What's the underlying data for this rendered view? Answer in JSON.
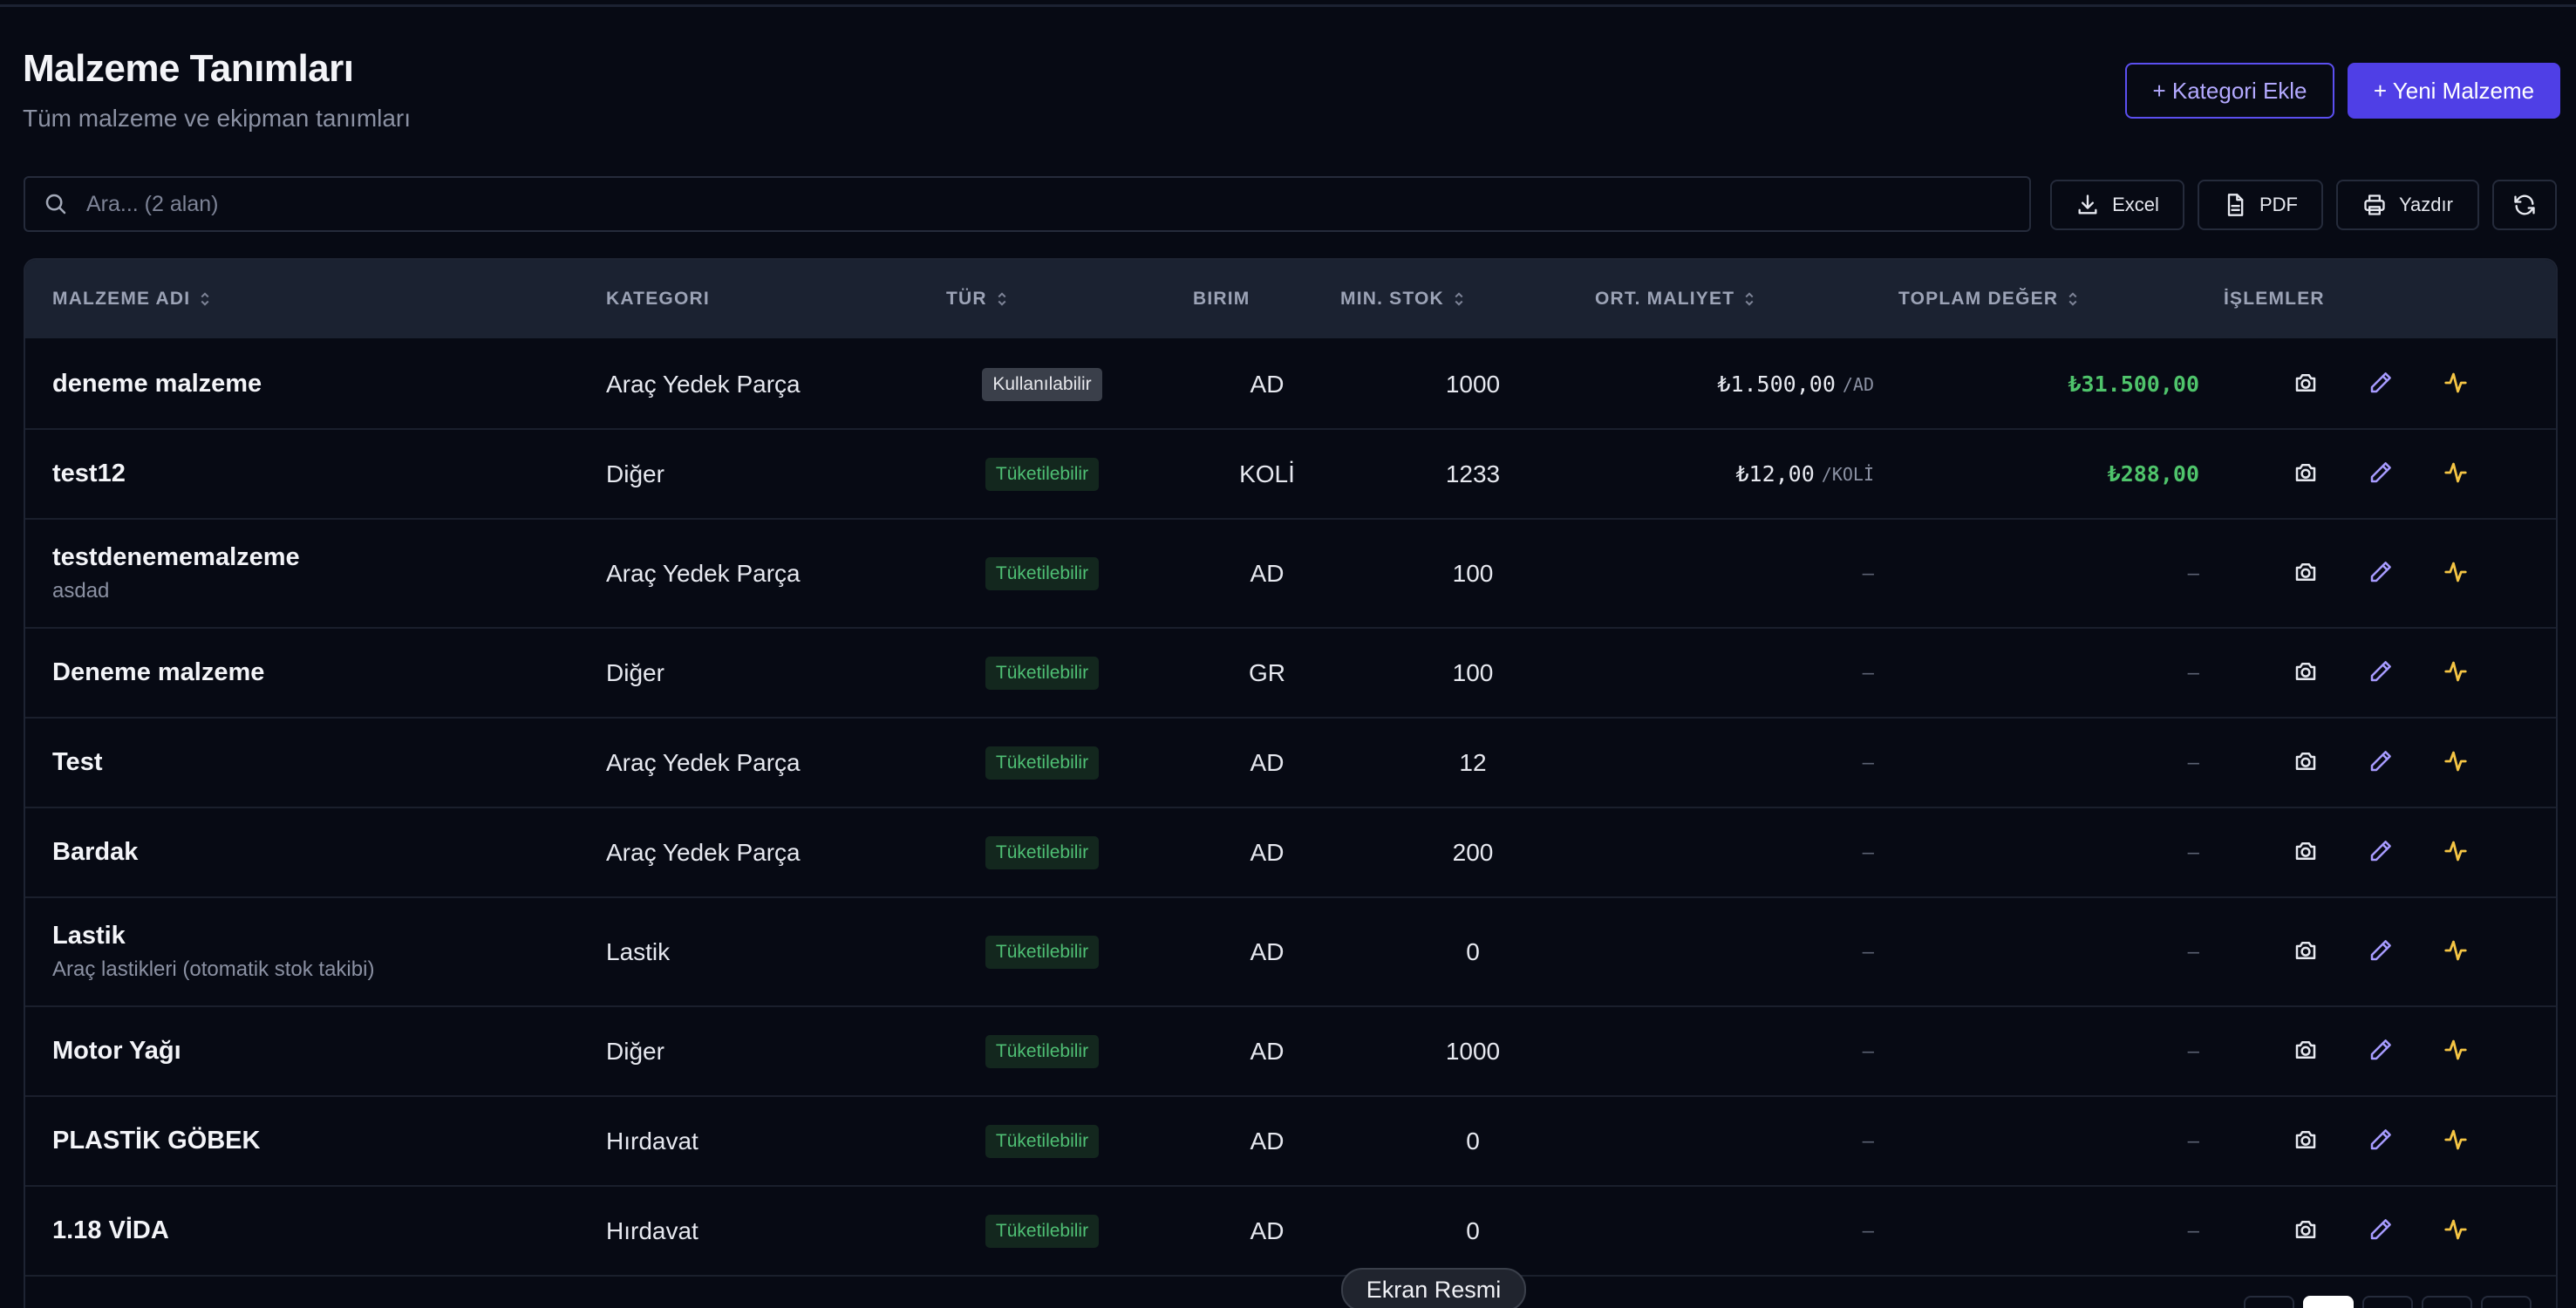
{
  "header": {
    "title": "Malzeme Tanımları",
    "subtitle": "Tüm malzeme ve ekipman tanımları",
    "add_category_label": "+ Kategori Ekle",
    "new_item_label": "+ Yeni Malzeme"
  },
  "toolbar": {
    "search_placeholder": "Ara... (2 alan)",
    "search_value": "",
    "excel_label": "Excel",
    "pdf_label": "PDF",
    "print_label": "Yazdır"
  },
  "table": {
    "columns": [
      "MALZEME ADI",
      "KATEGORI",
      "TÜR",
      "BIRIM",
      "MIN. STOK",
      "ORT. MALIYET",
      "TOPLAM DEĞER",
      "İŞLEMLER"
    ],
    "rows": [
      {
        "name": "deneme malzeme",
        "desc": "",
        "category": "Araç Yedek Parça",
        "type": "Kullanılabilir",
        "type_style": "gray",
        "unit": "AD",
        "min_stock": "1000",
        "avg_cost": "₺1.500,00",
        "cost_unit": "/AD",
        "total": "₺31.500,00"
      },
      {
        "name": "test12",
        "desc": "",
        "category": "Diğer",
        "type": "Tüketilebilir",
        "type_style": "green",
        "unit": "KOLİ",
        "min_stock": "1233",
        "avg_cost": "₺12,00",
        "cost_unit": "/KOLİ",
        "total": "₺288,00"
      },
      {
        "name": "testdenememalzeme",
        "desc": "asdad",
        "category": "Araç Yedek Parça",
        "type": "Tüketilebilir",
        "type_style": "green",
        "unit": "AD",
        "min_stock": "100",
        "avg_cost": "–",
        "cost_unit": "",
        "total": "–"
      },
      {
        "name": "Deneme malzeme",
        "desc": "",
        "category": "Diğer",
        "type": "Tüketilebilir",
        "type_style": "green",
        "unit": "GR",
        "min_stock": "100",
        "avg_cost": "–",
        "cost_unit": "",
        "total": "–"
      },
      {
        "name": "Test",
        "desc": "",
        "category": "Araç Yedek Parça",
        "type": "Tüketilebilir",
        "type_style": "green",
        "unit": "AD",
        "min_stock": "12",
        "avg_cost": "–",
        "cost_unit": "",
        "total": "–"
      },
      {
        "name": "Bardak",
        "desc": "",
        "category": "Araç Yedek Parça",
        "type": "Tüketilebilir",
        "type_style": "green",
        "unit": "AD",
        "min_stock": "200",
        "avg_cost": "–",
        "cost_unit": "",
        "total": "–"
      },
      {
        "name": "Lastik",
        "desc": "Araç lastikleri (otomatik stok takibi)",
        "category": "Lastik",
        "type": "Tüketilebilir",
        "type_style": "green",
        "unit": "AD",
        "min_stock": "0",
        "avg_cost": "–",
        "cost_unit": "",
        "total": "–"
      },
      {
        "name": "Motor Yağı",
        "desc": "",
        "category": "Diğer",
        "type": "Tüketilebilir",
        "type_style": "green",
        "unit": "AD",
        "min_stock": "1000",
        "avg_cost": "–",
        "cost_unit": "",
        "total": "–"
      },
      {
        "name": "PLASTİK GÖBEK",
        "desc": "",
        "category": "Hırdavat",
        "type": "Tüketilebilir",
        "type_style": "green",
        "unit": "AD",
        "min_stock": "0",
        "avg_cost": "–",
        "cost_unit": "",
        "total": "–"
      },
      {
        "name": "1.18 VİDA",
        "desc": "",
        "category": "Hırdavat",
        "type": "Tüketilebilir",
        "type_style": "green",
        "unit": "AD",
        "min_stock": "0",
        "avg_cost": "–",
        "cost_unit": "",
        "total": "–"
      }
    ],
    "actions": [
      "camera-icon",
      "pencil-icon",
      "activity-icon"
    ]
  },
  "overlay": {
    "screenshot_label": "Ekran Resmi"
  },
  "colors": {
    "background": "#070a14",
    "accent": "#4f3fe6",
    "accent_light": "#b3a9ff",
    "success": "#4fc46b",
    "warning_icon": "#f5c544"
  }
}
